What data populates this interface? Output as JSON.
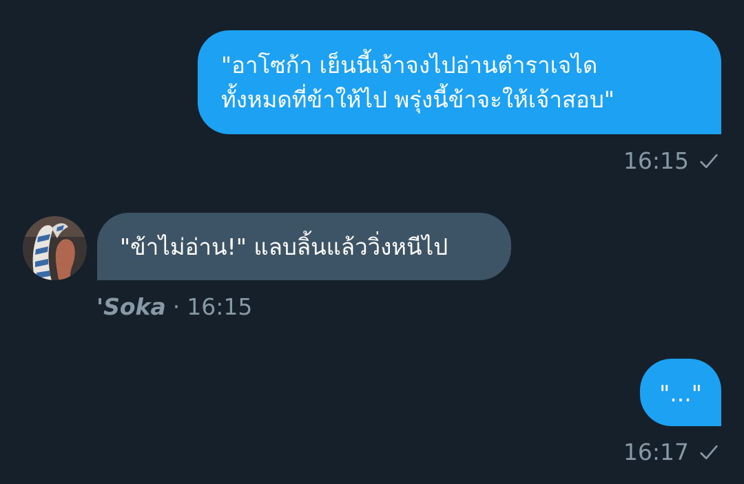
{
  "messages": [
    {
      "direction": "outgoing",
      "text": "\"อาโซก้า เย็นนี้เจ้าจงไปอ่านตำราเจได\nทั้งหมดที่ข้าให้ไป พรุ่งนี้ข้าจะให้เจ้าสอบ\"",
      "time": "16:15"
    },
    {
      "direction": "incoming",
      "text": "\"ข้าไม่อ่าน!\" แลบลิ้นแล้ววิ่งหนีไป",
      "sender": "'Soka",
      "separator": "·",
      "time": "16:15"
    },
    {
      "direction": "outgoing",
      "text": "\"...\"",
      "time": "16:17"
    }
  ],
  "icons": {
    "read_receipt": "check-icon",
    "avatar": "avatar"
  },
  "colors": {
    "background": "#15202b",
    "outgoing_bubble": "#1da1f2",
    "incoming_bubble": "#3d5466",
    "meta_text": "#8899a6"
  }
}
